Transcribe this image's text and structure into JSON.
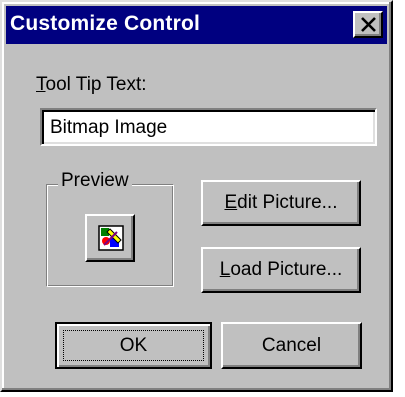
{
  "window": {
    "title": "Customize Control"
  },
  "tooltip": {
    "label_mnemonic": "T",
    "label_rest": "ool Tip Text:",
    "value": "Bitmap Image"
  },
  "preview": {
    "legend": "Preview",
    "icon": "bitmap-picture-icon"
  },
  "buttons": {
    "edit_mnemonic": "E",
    "edit_rest": "dit Picture...",
    "load_mnemonic": "L",
    "load_rest": "oad Picture...",
    "ok_label": "OK",
    "cancel_label": "Cancel"
  },
  "icons": {
    "close": "close-icon"
  },
  "colors": {
    "titlebar": "#000080",
    "face": "#c0c0c0"
  }
}
